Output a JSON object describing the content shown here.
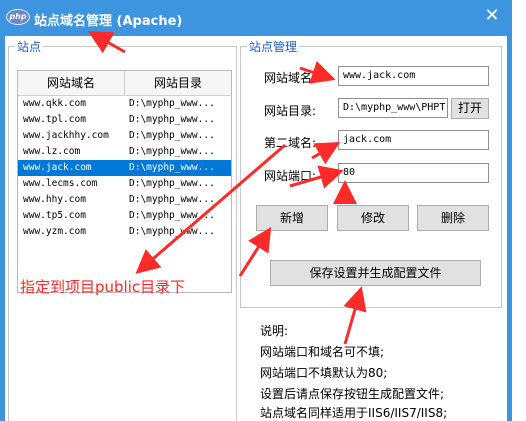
{
  "window": {
    "title": "站点域名管理 (Apache)",
    "logo_text": "php"
  },
  "left_group": {
    "title": "站点",
    "columns": [
      "网站域名",
      "网站目录"
    ],
    "rows": [
      {
        "domain": "www.qkk.com",
        "dir": "D:\\myphp_www..."
      },
      {
        "domain": "www.tpl.com",
        "dir": "D:\\myphp_www..."
      },
      {
        "domain": "www.jackhhy.com",
        "dir": "D:\\myphp_www..."
      },
      {
        "domain": "www.lz.com",
        "dir": "D:\\myphp_www..."
      },
      {
        "domain": "www.jack.com",
        "dir": "D:\\myphp_www..."
      },
      {
        "domain": "www.lecms.com",
        "dir": "D:\\myphp_www..."
      },
      {
        "domain": "www.hhy.com",
        "dir": "D:\\myphp_www..."
      },
      {
        "domain": "www.tp5.com",
        "dir": "D:\\myphp_www..."
      },
      {
        "domain": "www.yzm.com",
        "dir": "D:\\myphp_www..."
      }
    ]
  },
  "manage": {
    "title": "站点管理",
    "domain_label": "网站域名:",
    "domain_value": "www.jack.com",
    "dir_label": "网站目录:",
    "dir_value": "D:\\myphp_www\\PHPT",
    "open_label": "打开",
    "second_label": "第二域名:",
    "second_value": "jack.com",
    "port_label": "网站端口:",
    "port_value": "80",
    "add_label": "新增",
    "edit_label": "修改",
    "delete_label": "删除",
    "save_label": "保存设置并生成配置文件"
  },
  "notes": [
    "说明:",
    "网站端口和域名可不填;",
    "网站端口不填默认为80;",
    "设置后请点保存按钮生成配置文件;",
    "站点域名同样适用于IIS6/IIS7/IIS8;"
  ],
  "annotation": "指定到项目public目录下",
  "colors": {
    "titlebar": "#3c95de",
    "selection": "#0078d7",
    "group_title": "#1d5fbf",
    "annotation": "#ff2a2a"
  }
}
